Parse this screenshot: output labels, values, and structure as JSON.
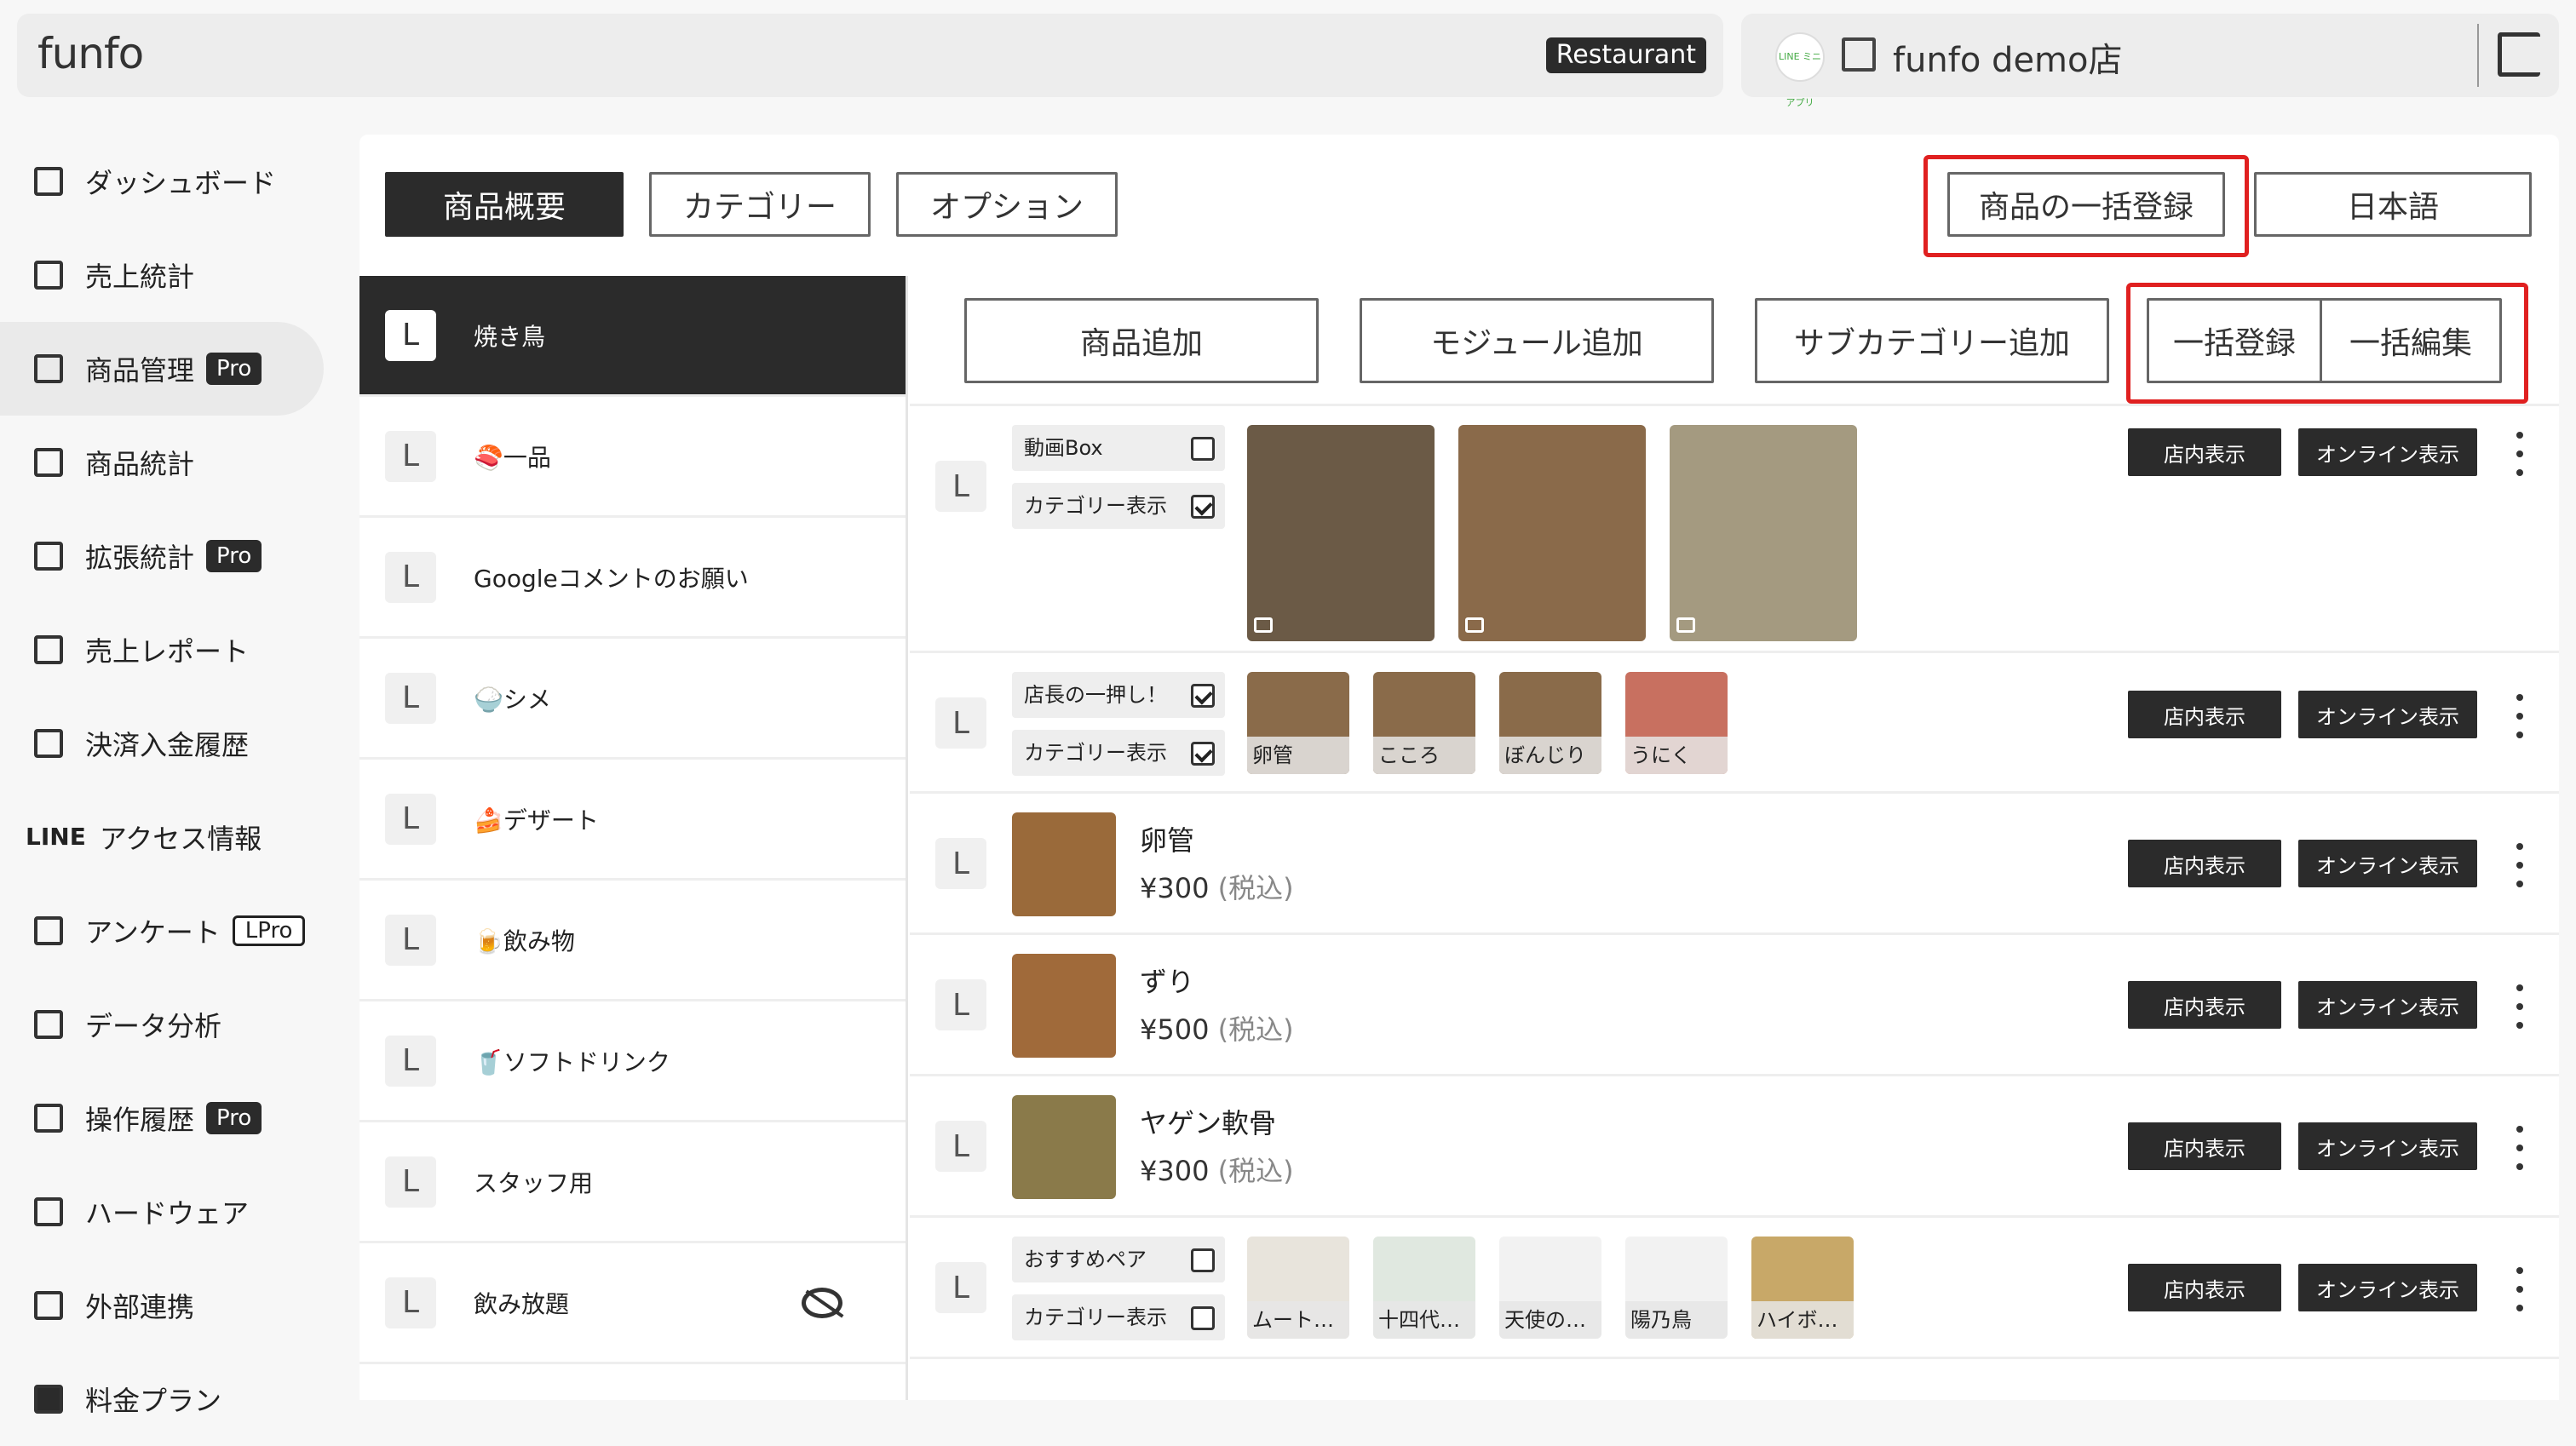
{
  "header": {
    "logo": "funfo",
    "tag": "Restaurant",
    "store_icon": "LINE ミニアプリ",
    "store_name": "funfo demo店"
  },
  "nav": [
    {
      "label": "ダッシュボード",
      "icon": "home-icon"
    },
    {
      "label": "売上統計",
      "icon": "bar-chart-icon"
    },
    {
      "label": "商品管理",
      "icon": "grid-icon",
      "badge": "Pro",
      "active": true
    },
    {
      "label": "商品統計",
      "icon": "tiles-icon"
    },
    {
      "label": "拡張統計",
      "icon": "chart-icon",
      "badge": "Pro"
    },
    {
      "label": "売上レポート",
      "icon": "report-icon"
    },
    {
      "label": "決済入金履歴",
      "icon": "payment-icon"
    },
    {
      "label": "アクセス情報",
      "icon": "line-icon",
      "prefix": "LINE"
    },
    {
      "label": "アンケート",
      "icon": "survey-icon",
      "badge": "LPro",
      "outline": true
    },
    {
      "label": "データ分析",
      "icon": "analysis-icon"
    },
    {
      "label": "操作履歴",
      "icon": "history-icon",
      "badge": "Pro"
    },
    {
      "label": "ハードウェア",
      "icon": "hardware-icon"
    },
    {
      "label": "外部連携",
      "icon": "link-icon"
    },
    {
      "label": "料金プラン",
      "icon": "pro-icon"
    }
  ],
  "tabs": {
    "overview": "商品概要",
    "category": "カテゴリー",
    "option": "オプション",
    "bulk_register": "商品の一括登録",
    "language": "日本語"
  },
  "actions": {
    "add_item": "商品追加",
    "add_module": "モジュール追加",
    "add_subcategory": "サブカテゴリー追加",
    "bulk_add": "一括登録",
    "bulk_edit": "一括編集"
  },
  "categories": [
    {
      "label": "焼き鳥",
      "selected": true
    },
    {
      "label": "🍣一品"
    },
    {
      "label": "Googleコメントのお願い"
    },
    {
      "label": "🍚シメ"
    },
    {
      "label": "🍰デザート"
    },
    {
      "label": "🍺飲み物"
    },
    {
      "label": "🥤ソフトドリンク"
    },
    {
      "label": "スタッフ用"
    },
    {
      "label": "飲み放題",
      "hidden": true
    }
  ],
  "l": "L",
  "rows": {
    "r1": {
      "opt1": "動画Box",
      "opt2": "カテゴリー表示"
    },
    "r2": {
      "opt1": "店長の一押し！",
      "opt2": "カテゴリー表示",
      "caps": [
        "卵管",
        "こころ",
        "ぼんじり",
        "うにく"
      ]
    },
    "p1": {
      "name": "卵管",
      "price": "¥300",
      "tax": "(税込)"
    },
    "p2": {
      "name": "ずり",
      "price": "¥500",
      "tax": "(税込)"
    },
    "p3": {
      "name": "ヤゲン軟骨",
      "price": "¥300",
      "tax": "(税込)"
    },
    "r6": {
      "opt1": "おすすめペア",
      "opt2": "カテゴリー表示",
      "caps": [
        "ムート…",
        "十四代…",
        "天使の…",
        "陽乃鳥",
        "ハイボ…"
      ]
    }
  },
  "row_buttons": {
    "store": "店内表示",
    "online": "オンライン表示"
  }
}
